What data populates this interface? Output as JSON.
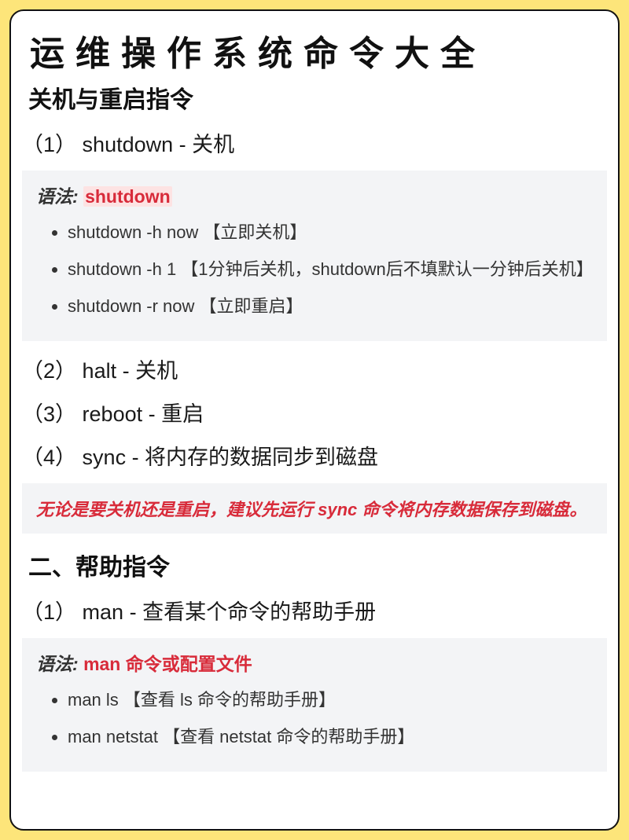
{
  "title": "运维操作系统命令大全",
  "section1": {
    "heading": "关机与重启指令",
    "items": [
      {
        "num": "（1）",
        "text": "shutdown - 关机"
      },
      {
        "num": "（2）",
        "text": "halt - 关机"
      },
      {
        "num": "（3）",
        "text": "reboot - 重启"
      },
      {
        "num": "（4）",
        "text": "sync - 将内存的数据同步到磁盘"
      }
    ],
    "syntax_label": "语法:",
    "syntax_kw": "shutdown",
    "examples": [
      "shutdown -h now 【立即关机】",
      "shutdown -h 1 【1分钟后关机，shutdown后不填默认一分钟后关机】",
      "shutdown -r now 【立即重启】"
    ],
    "note": "无论是要关机还是重启，建议先运行 sync 命令将内存数据保存到磁盘。"
  },
  "section2": {
    "heading": "二、帮助指令",
    "items": [
      {
        "num": "（1）",
        "text": "man - 查看某个命令的帮助手册"
      }
    ],
    "syntax_label": "语法:",
    "syntax_kw": "man 命令或配置文件",
    "examples": [
      "man ls 【查看 ls 命令的帮助手册】",
      "man netstat 【查看 netstat 命令的帮助手册】"
    ]
  }
}
